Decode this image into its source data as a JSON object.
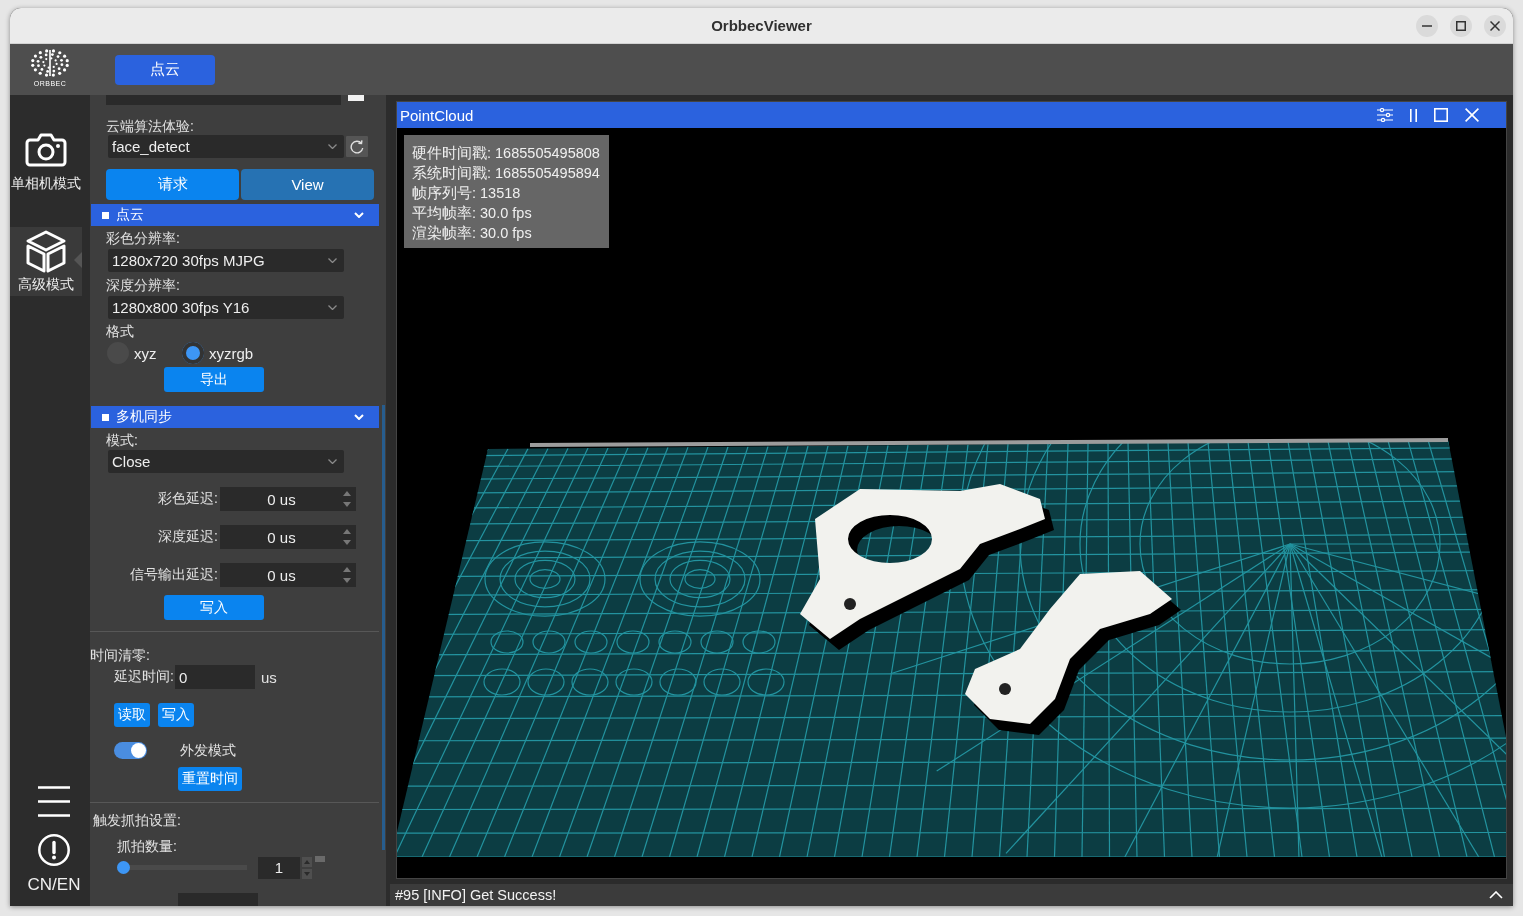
{
  "window": {
    "title": "OrbbecViewer"
  },
  "toolbar": {
    "logo_text": "ORBBEC",
    "tabs": [
      {
        "label": "点云",
        "selected": true
      }
    ]
  },
  "sidebar": {
    "items": [
      {
        "kind": "camera",
        "label": "单相机模式",
        "selected": false
      },
      {
        "kind": "cube",
        "label": "高级模式",
        "selected": true
      }
    ],
    "language": "CN/EN"
  },
  "settings": {
    "cloud_algorithm": {
      "label": "云端算法体验:",
      "value": "face_detect",
      "buttons": [
        {
          "label": "请求",
          "kind": "primary"
        },
        {
          "label": "View",
          "kind": "secondary"
        }
      ]
    },
    "point_cloud": {
      "title": "点云",
      "expanded": true,
      "color_resolution": {
        "label": "彩色分辨率:",
        "value": "1280x720 30fps MJPG"
      },
      "depth_resolution": {
        "label": "深度分辨率:",
        "value": "1280x800 30fps Y16"
      },
      "format": {
        "label": "格式",
        "options": [
          {
            "label": "xyz",
            "selected": false
          },
          {
            "label": "xyzrgb",
            "selected": true
          }
        ]
      },
      "export_button": "导出"
    },
    "multi_sync": {
      "title": "多机同步",
      "expanded": true,
      "mode": {
        "label": "模式:",
        "value": "Close"
      },
      "delays": [
        {
          "label": "彩色延迟:",
          "value": "0 us"
        },
        {
          "label": "深度延迟:",
          "value": "0 us"
        },
        {
          "label": "信号输出延迟:",
          "value": "0 us"
        }
      ],
      "write_button": "写入"
    },
    "time_reset": {
      "label": "时间清零:",
      "delay": {
        "label": "延迟时间:",
        "value": "0",
        "unit": "us"
      },
      "buttons": [
        "读取",
        "写入"
      ],
      "external_mode": {
        "label": "外发模式",
        "on": true
      },
      "reset_button": "重置时间"
    },
    "trigger_capture": {
      "label": "触发抓拍设置:",
      "count": {
        "label": "抓拍数量:",
        "level": 0,
        "value": "1"
      }
    }
  },
  "viewer": {
    "title": "PointCloud",
    "info_lines": [
      "硬件时间戳: 1685505495808",
      "系统时间戳: 1685505495894",
      "帧序列号: 13518",
      "平均帧率: 30.0 fps",
      "渲染帧率: 30.0 fps"
    ]
  },
  "status_bar": {
    "message": "#95 [INFO] Get Success!"
  }
}
